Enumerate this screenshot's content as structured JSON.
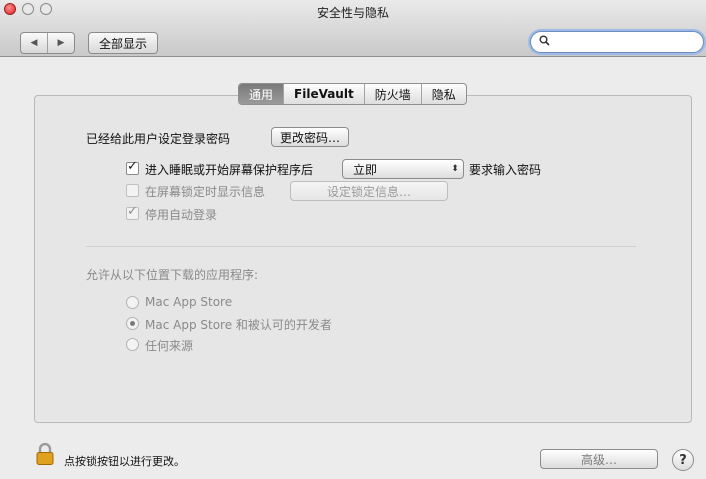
{
  "window": {
    "title": "安全性与隐私",
    "show_all_label": "全部显示",
    "back_icon": "◀",
    "forward_icon": "▶"
  },
  "search": {
    "value": "",
    "placeholder": ""
  },
  "tabs": [
    {
      "label": "通用",
      "active": true
    },
    {
      "label": "FileVault",
      "active": false
    },
    {
      "label": "防火墙",
      "active": false
    },
    {
      "label": "隐私",
      "active": false
    }
  ],
  "general": {
    "password_set_text": "已经给此用户设定登录密码",
    "change_password_label": "更改密码…",
    "require_password": {
      "checked": true,
      "label": "进入睡眠或开始屏幕保护程序后",
      "popup_value": "立即",
      "suffix": "要求输入密码"
    },
    "lock_message": {
      "checked": false,
      "label": "在屏幕锁定时显示信息",
      "button_label": "设定锁定信息…"
    },
    "disable_autologin": {
      "checked": true,
      "label": "停用自动登录"
    }
  },
  "downloads": {
    "heading": "允许从以下位置下载的应用程序:",
    "options": [
      {
        "label": "Mac App Store",
        "selected": false
      },
      {
        "label": "Mac App Store 和被认可的开发者",
        "selected": true
      },
      {
        "label": "任何来源",
        "selected": false
      }
    ]
  },
  "footer": {
    "lock_text": "点按锁按钮以进行更改。",
    "advanced_label": "高级…",
    "help_label": "?"
  }
}
